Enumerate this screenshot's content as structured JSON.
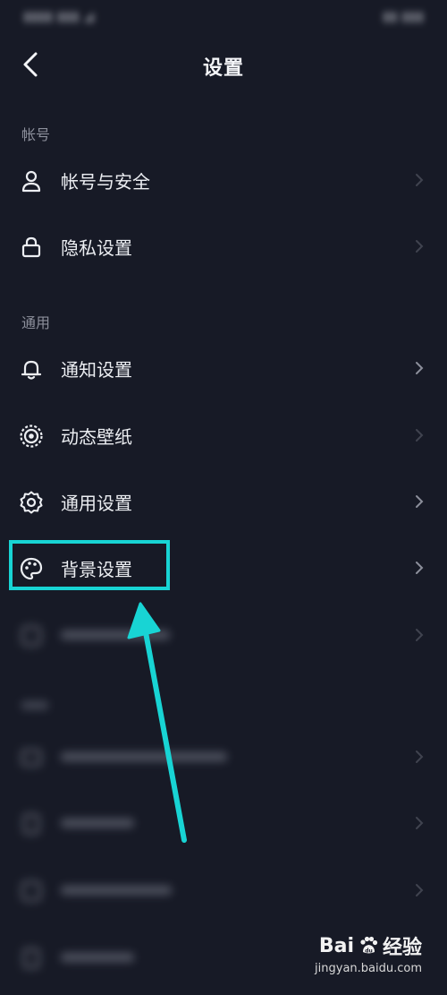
{
  "header": {
    "title": "设置"
  },
  "sections": {
    "account": "帐号",
    "general": "通用"
  },
  "rows": {
    "account_security": "帐号与安全",
    "privacy": "隐私设置",
    "notification": "通知设置",
    "wallpaper": "动态壁纸",
    "general_settings": "通用设置",
    "background": "背景设置"
  },
  "watermark": {
    "brand_left": "Bai",
    "brand_right": "经验",
    "url": "jingyan.baidu.com"
  },
  "colors": {
    "background": "#171a26",
    "highlight": "#18d4d4",
    "text": "#eceef2",
    "muted": "#8c8f9b"
  }
}
